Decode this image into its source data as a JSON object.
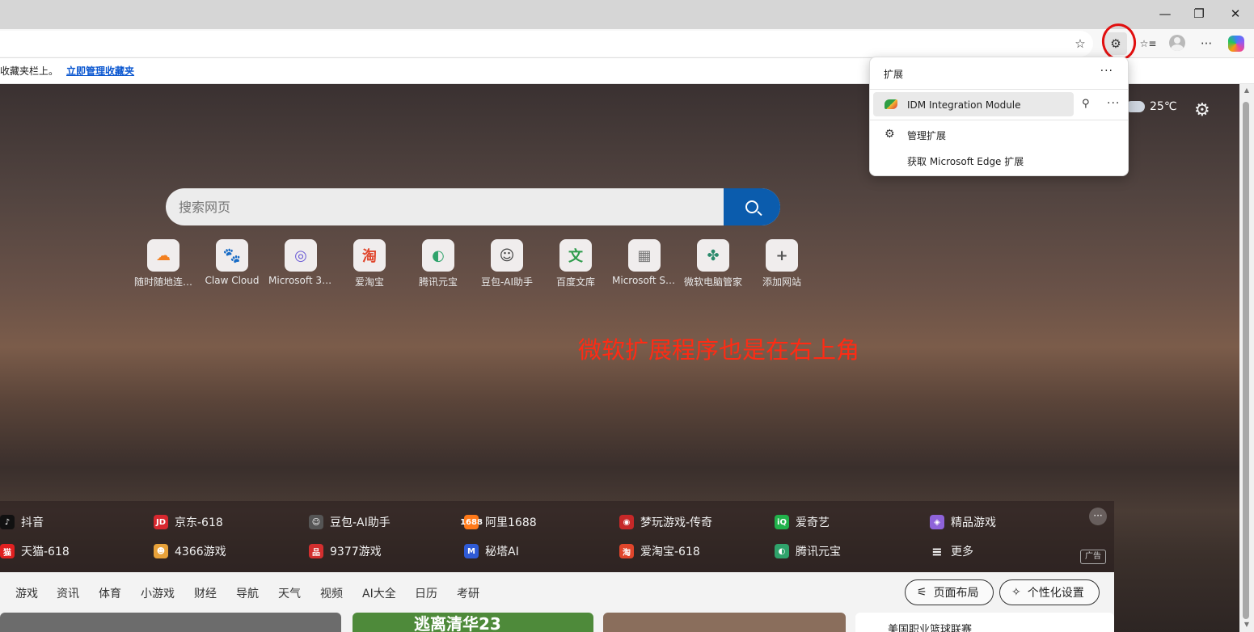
{
  "window": {
    "minimize": "—",
    "restore": "❐",
    "close": "✕"
  },
  "toolbar": {
    "favorite_icon": "star-outline-icon",
    "favorite_glyph": "☆",
    "extensions_glyph": "⚙",
    "favorites_list_glyph": "☆≡",
    "more_glyph": "···"
  },
  "favorites_bar": {
    "text": "收藏夹栏上。",
    "link": "立即管理收藏夹"
  },
  "weather": {
    "temp": "25℃"
  },
  "settings_glyph": "⚙",
  "search": {
    "placeholder": "搜索网页"
  },
  "quick_links": [
    {
      "label": "随时随地连…",
      "glyph": "☁",
      "color": "#f38020"
    },
    {
      "label": "Claw Cloud",
      "glyph": "🐾",
      "color": "#111111"
    },
    {
      "label": "Microsoft 365",
      "glyph": "◎",
      "color": "#6b5bd6"
    },
    {
      "label": "爱淘宝",
      "glyph": "淘",
      "color": "#e0452b"
    },
    {
      "label": "腾讯元宝",
      "glyph": "◐",
      "color": "#2fa36b"
    },
    {
      "label": "豆包-AI助手",
      "glyph": "☺",
      "color": "#444444"
    },
    {
      "label": "百度文库",
      "glyph": "文",
      "color": "#2e9c4c"
    },
    {
      "label": "Microsoft St…",
      "glyph": "▦",
      "color": "#777777"
    },
    {
      "label": "微软电脑管家",
      "glyph": "✤",
      "color": "#2a8a6b"
    },
    {
      "label": "添加网站",
      "glyph": "+",
      "color": "#555555"
    }
  ],
  "annotation": "微软扩展程序也是在右上角",
  "sites": [
    {
      "label": "抖音",
      "glyph": "♪",
      "color": "#111111"
    },
    {
      "label": "京东-618",
      "glyph": "JD",
      "color": "#d7282f"
    },
    {
      "label": "豆包-AI助手",
      "glyph": "☺",
      "color": "#555555"
    },
    {
      "label": "阿里1688",
      "glyph": "1688",
      "color": "#ff7a1a"
    },
    {
      "label": "梦玩游戏-传奇",
      "glyph": "◉",
      "color": "#c62828"
    },
    {
      "label": "爱奇艺",
      "glyph": "iQ",
      "color": "#21b24b"
    },
    {
      "label": "精品游戏",
      "glyph": "◈",
      "color": "#8e63d9"
    },
    {
      "label": "天猫-618",
      "glyph": "猫",
      "color": "#e02020"
    },
    {
      "label": "4366游戏",
      "glyph": "☻",
      "color": "#e8a23a"
    },
    {
      "label": "9377游戏",
      "glyph": "品",
      "color": "#d32f2f"
    },
    {
      "label": "秘塔AI",
      "glyph": "M",
      "color": "#2f5bd6"
    },
    {
      "label": "爱淘宝-618",
      "glyph": "淘",
      "color": "#e0452b"
    },
    {
      "label": "腾讯元宝",
      "glyph": "◐",
      "color": "#2fa36b"
    },
    {
      "label": "更多",
      "glyph": "≡",
      "color": "transparent"
    }
  ],
  "sites_more": "···",
  "ad_label": "广告",
  "nav": {
    "items": [
      "游戏",
      "资讯",
      "体育",
      "小游戏",
      "财经",
      "导航",
      "天气",
      "视频",
      "AI大全",
      "日历",
      "考研"
    ],
    "layout_button": "页面布局",
    "personalize_button": "个性化设置"
  },
  "cards": {
    "card2_text": "逃离清华23",
    "card4_text": "美国职业篮球联赛"
  },
  "extensions_popup": {
    "title": "扩展",
    "more": "···",
    "extension_name": "IDM Integration Module",
    "pin": "📌",
    "row_more": "···",
    "manage": "管理扩展",
    "get": "获取 Microsoft Edge 扩展"
  }
}
